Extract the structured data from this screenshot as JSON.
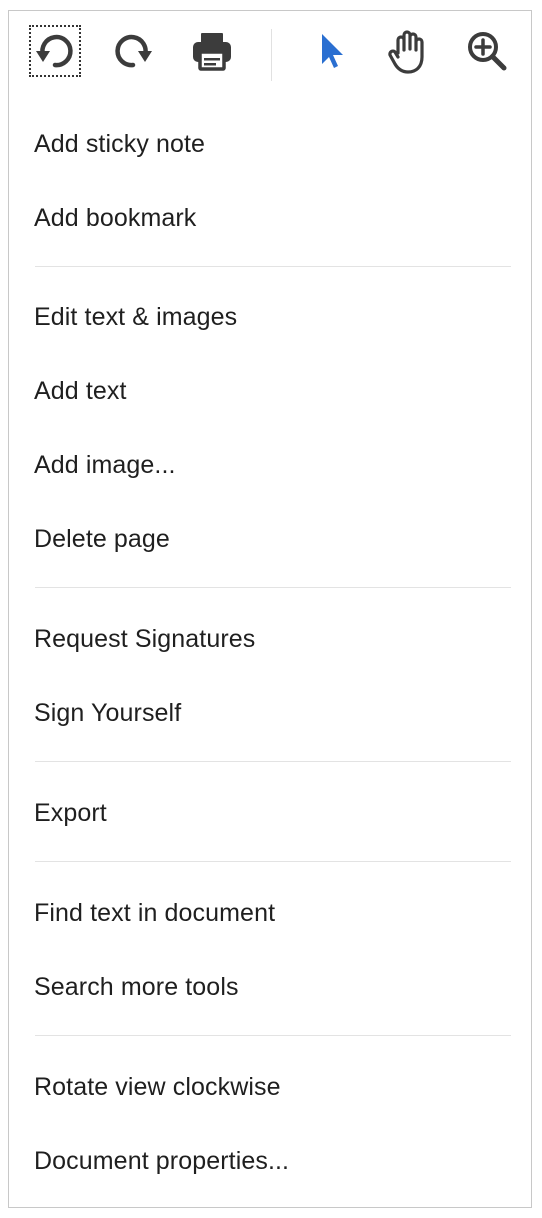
{
  "toolbar": {
    "buttons": [
      {
        "name": "undo",
        "icon": "undo-icon"
      },
      {
        "name": "redo",
        "icon": "redo-icon"
      },
      {
        "name": "print",
        "icon": "print-icon"
      },
      {
        "name": "select",
        "icon": "cursor-arrow-icon"
      },
      {
        "name": "pan",
        "icon": "hand-icon"
      },
      {
        "name": "zoom-in",
        "icon": "zoom-in-icon"
      }
    ],
    "accent": "#2a6fd1",
    "icon_color": "#3c3c3c"
  },
  "menu": {
    "items": [
      {
        "label": "Add sticky note"
      },
      {
        "label": "Add bookmark"
      },
      {
        "label": "Edit text & images"
      },
      {
        "label": "Add text"
      },
      {
        "label": "Add image..."
      },
      {
        "label": "Delete page"
      },
      {
        "label": "Request Signatures"
      },
      {
        "label": "Sign Yourself"
      },
      {
        "label": "Export"
      },
      {
        "label": "Find text in document"
      },
      {
        "label": "Search more tools"
      },
      {
        "label": "Rotate view clockwise"
      },
      {
        "label": "Document properties..."
      }
    ]
  }
}
